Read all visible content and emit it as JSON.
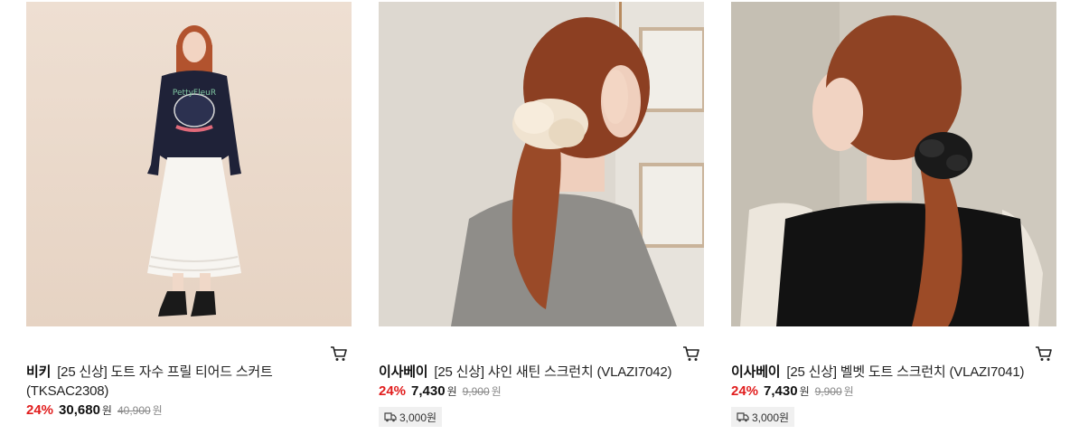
{
  "products": [
    {
      "brand": "비키",
      "name": "[25 신상] 도트 자수 프릴 티어드 스커트 (TKSAC2308)",
      "discount": "24%",
      "price": "30,680",
      "currency": "원",
      "original_price": "40,900",
      "original_currency": "원",
      "shipping": "",
      "image_icon": "model-photo"
    },
    {
      "brand": "이사베이",
      "name": "[25 신상] 샤인 새틴 스크런치 (VLAZI7042)",
      "discount": "24%",
      "price": "7,430",
      "currency": "원",
      "original_price": "9,900",
      "original_currency": "원",
      "shipping": "3,000원",
      "image_icon": "model-photo"
    },
    {
      "brand": "이사베이",
      "name": "[25 신상] 벨벳 도트 스크런치 (VLAZI7041)",
      "discount": "24%",
      "price": "7,430",
      "currency": "원",
      "original_price": "9,900",
      "original_currency": "원",
      "shipping": "3,000원",
      "image_icon": "model-photo"
    }
  ],
  "icons": {
    "cart": "cart-icon",
    "shipping": "truck-icon"
  },
  "colors": {
    "discount": "#e11d1d",
    "ship_bg": "#f0f0f0"
  }
}
